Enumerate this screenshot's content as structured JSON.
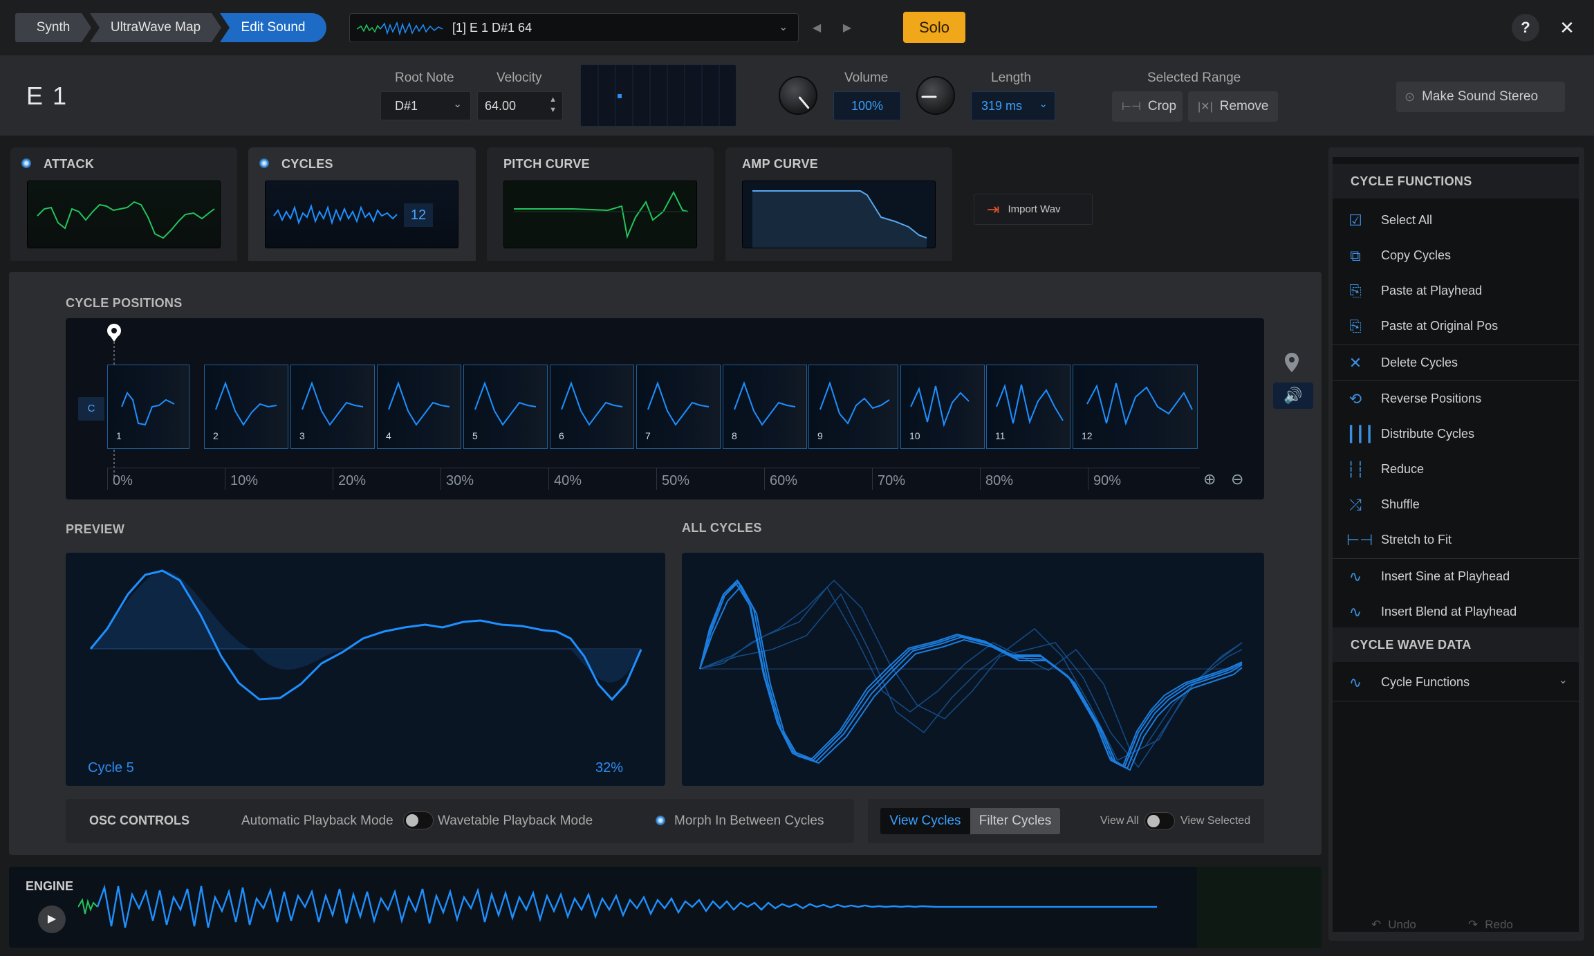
{
  "breadcrumb": [
    "Synth",
    "UltraWave Map",
    "Edit Sound"
  ],
  "preset": {
    "name": "[1] E 1 D#1 64"
  },
  "solo": "Solo",
  "help": "?",
  "close": "✕",
  "header": {
    "note_name": "E 1",
    "root_note_label": "Root Note",
    "root_note_value": "D#1",
    "velocity_label": "Velocity",
    "velocity_value": "64.00",
    "volume_label": "Volume",
    "volume_value": "100%",
    "length_label": "Length",
    "length_value": "319 ms",
    "range_label": "Selected Range",
    "crop": "Crop",
    "remove": "Remove",
    "stereo": "Make Sound Stereo"
  },
  "tabs": {
    "attack": "ATTACK",
    "cycles": "CYCLES",
    "cycles_count": "12",
    "pitch": "PITCH CURVE",
    "amp": "AMP CURVE"
  },
  "import_wav": "Import Wav",
  "cycle_positions": {
    "title": "CYCLE POSITIONS",
    "c_label": "C",
    "cycles": [
      "1",
      "2",
      "3",
      "4",
      "5",
      "6",
      "7",
      "8",
      "9",
      "10",
      "11",
      "12"
    ],
    "ticks": [
      "0%",
      "10%",
      "20%",
      "30%",
      "40%",
      "50%",
      "60%",
      "70%",
      "80%",
      "90%"
    ]
  },
  "preview": {
    "title": "PREVIEW",
    "cycle": "Cycle 5",
    "percent": "32%"
  },
  "all_cycles": {
    "title": "ALL CYCLES"
  },
  "osc": {
    "title": "OSC CONTROLS",
    "auto": "Automatic Playback Mode",
    "wavetable": "Wavetable Playback Mode",
    "morph": "Morph In Between Cycles"
  },
  "view": {
    "view_cycles": "View Cycles",
    "filter_cycles": "Filter Cycles",
    "view_all": "View All",
    "view_selected": "View Selected"
  },
  "engine": {
    "title": "ENGINE"
  },
  "sidebar": {
    "head1": "CYCLE FUNCTIONS",
    "items": [
      "Select All",
      "Copy Cycles",
      "Paste at Playhead",
      "Paste at Original Pos",
      "Delete Cycles",
      "Reverse Positions",
      "Distribute Cycles",
      "Reduce",
      "Shuffle",
      "Stretch to Fit",
      "Insert Sine at Playhead",
      "Insert Blend at Playhead"
    ],
    "head2": "CYCLE WAVE DATA",
    "wave_data": "Cycle Functions",
    "undo": "Undo",
    "redo": "Redo"
  },
  "colors": {
    "accent": "#1d6bc4",
    "solo": "#f0a81a",
    "wave_blue": "#1e90ff",
    "wave_green": "#22c55e"
  }
}
